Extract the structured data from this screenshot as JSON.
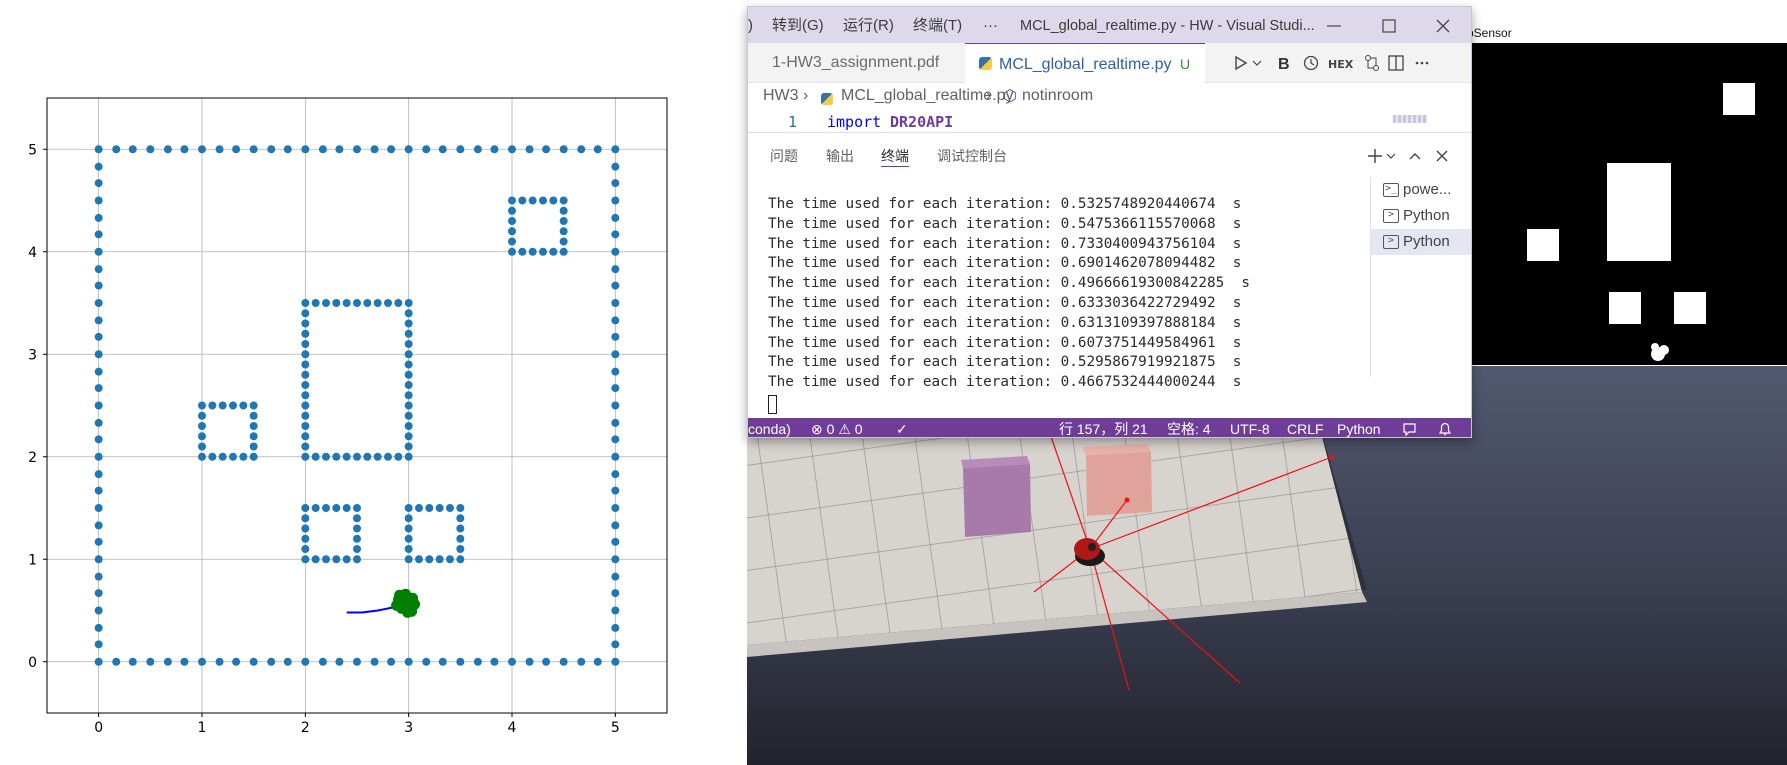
{
  "plot": {
    "x_ticks": [
      "0",
      "1",
      "2",
      "3",
      "4",
      "5"
    ],
    "y_ticks": [
      "0",
      "1",
      "2",
      "3",
      "4",
      "5"
    ],
    "marker_color": "#1f77b4",
    "path_color": "#0000ff",
    "robot_color": "#008000"
  },
  "chart_data": {
    "type": "scatter",
    "xlim": [
      -0.5,
      5.5
    ],
    "ylim": [
      -0.5,
      5.5
    ],
    "grid": true,
    "outer_wall": {
      "x_range": [
        0,
        5
      ],
      "y_range": [
        0,
        5
      ]
    },
    "obstacles": [
      {
        "x_range": [
          4.0,
          4.5
        ],
        "y_range": [
          4.0,
          4.5
        ]
      },
      {
        "x_range": [
          2.0,
          3.0
        ],
        "y_range": [
          2.0,
          3.5
        ]
      },
      {
        "x_range": [
          1.0,
          1.5
        ],
        "y_range": [
          2.0,
          2.5
        ]
      },
      {
        "x_range": [
          2.0,
          2.5
        ],
        "y_range": [
          1.0,
          1.5
        ]
      },
      {
        "x_range": [
          3.0,
          3.5
        ],
        "y_range": [
          1.0,
          1.5
        ]
      }
    ],
    "trajectory": {
      "x": [
        2.4,
        2.55,
        2.7,
        2.85,
        2.95
      ],
      "y": [
        0.48,
        0.48,
        0.5,
        0.53,
        0.57
      ]
    },
    "particles_center": {
      "x": 2.97,
      "y": 0.58
    }
  },
  "vscode": {
    "title": {
      "partial_left": ")",
      "menu_goto": "转到(G)",
      "menu_run": "运行(R)",
      "menu_terminal": "终端(T)",
      "menu_more": "···",
      "window_title": "MCL_global_realtime.py - HW - Visual Studi..."
    },
    "tabs": {
      "tab1": "1-HW3_assignment.pdf",
      "tab2": "MCL_global_realtime.py",
      "tab2_badge": "U",
      "tab2_close": "×"
    },
    "breadcrumb": {
      "folder": "HW3",
      "file": "MCL_global_realtime.py",
      "symbol": "notinroom"
    },
    "code": {
      "line_no": "1",
      "keyword": "import",
      "module": "DR20API"
    },
    "panel": {
      "tab_problems": "问题",
      "tab_output": "输出",
      "tab_terminal": "终端",
      "tab_debug": "调试控制台"
    },
    "terminal_lines": [
      "The time used for each iteration: 0.5325748920440674  s",
      "The time used for each iteration: 0.5475366115570068  s",
      "The time used for each iteration: 0.7330400943756104  s",
      "The time used for each iteration: 0.6901462078094482  s",
      "The time used for each iteration: 0.49666619300842285  s",
      "The time used for each iteration: 0.6333036422729492  s",
      "The time used for each iteration: 0.6313109397888184  s",
      "The time used for each iteration: 0.6073751449584961  s",
      "The time used for each iteration: 0.5295867919921875  s",
      "The time used for each iteration: 0.4667532444000244  s"
    ],
    "terminal_list": [
      "powe...",
      "Python",
      "Python"
    ],
    "status": {
      "env": "conda)",
      "errors": "0",
      "warnings": "0",
      "position": "行 157，列 21",
      "spaces": "空格: 4",
      "encoding": "UTF-8",
      "eol": "CRLF",
      "language": "Python"
    },
    "accent_color": "#6f3d98"
  },
  "sensor": {
    "title": "pSensor"
  }
}
